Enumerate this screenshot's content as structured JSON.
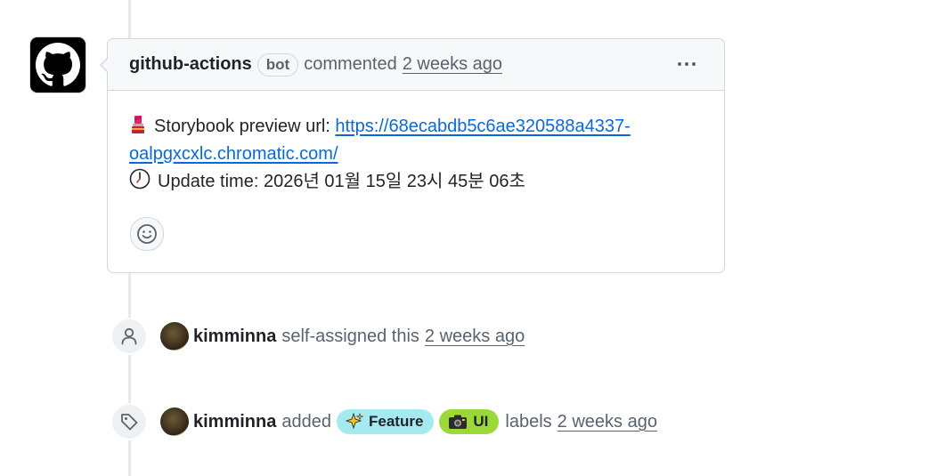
{
  "comment": {
    "author": "github-actions",
    "badge": "bot",
    "action": "commented",
    "time": "2 weeks ago",
    "body": {
      "preview_label": "Storybook preview url: ",
      "preview_url_line1": "https://68ecabdb5c6ae320588a4337-",
      "preview_url_line2": "oalpgxcxlc.chromatic.com/",
      "update_text": "Update time: 2026년 01월 15일 23시 45분 06초"
    },
    "icons": {
      "avatar": "github-logo-icon",
      "menu": "kebab-horizontal-icon",
      "reaction": "smiley-icon",
      "preview_emoji": "lipstick-icon",
      "update_emoji": "clock-icon"
    }
  },
  "events": [
    {
      "icon": "person-icon",
      "author": "kimminna",
      "text": "self-assigned this",
      "time": "2 weeks ago"
    },
    {
      "icon": "tag-icon",
      "author": "kimminna",
      "text": "added",
      "labels": [
        {
          "emoji": "sparkles-icon",
          "name": "Feature",
          "color": "#a5eaf0"
        },
        {
          "emoji": "camera-icon",
          "name": "UI",
          "color": "#9bd93a"
        }
      ],
      "suffix": "labels",
      "time": "2 weeks ago"
    }
  ],
  "colors": {
    "link": "#0969da",
    "muted": "#59636e",
    "border": "#d0d7de",
    "header_bg": "#f6f8fa"
  }
}
